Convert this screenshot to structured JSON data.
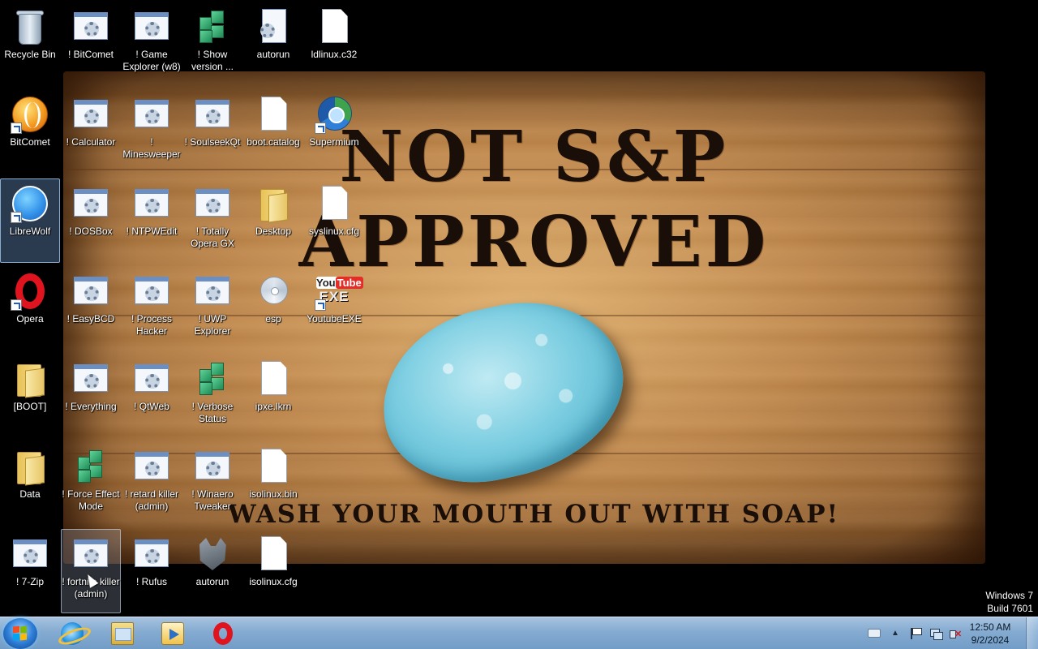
{
  "wallpaper": {
    "line1": "NOT S&P",
    "line2": "APPROVED",
    "bottom": "WASH YOUR MOUTH OUT WITH SOAP!"
  },
  "icons": [
    {
      "label": "Recycle Bin",
      "icon": "recycle-bin-icon"
    },
    {
      "label": "! BitComet",
      "icon": "app-icon"
    },
    {
      "label": "! Game Explorer (w8)",
      "icon": "app-icon"
    },
    {
      "label": "! Show version ...",
      "icon": "registry-icon"
    },
    {
      "label": "autorun",
      "icon": "settings-file-icon"
    },
    {
      "label": "ldlinux.c32",
      "icon": "file-icon"
    },
    {
      "label": "BitComet",
      "icon": "bitcomet-icon"
    },
    {
      "label": "! Calculator",
      "icon": "app-icon"
    },
    {
      "label": "! Minesweeper",
      "icon": "app-icon"
    },
    {
      "label": "! SoulseekQt",
      "icon": "app-icon"
    },
    {
      "label": "boot.catalog",
      "icon": "file-icon"
    },
    {
      "label": "Supermium",
      "icon": "supermium-icon"
    },
    {
      "label": "LibreWolf",
      "icon": "librewolf-icon"
    },
    {
      "label": "! DOSBox",
      "icon": "app-icon"
    },
    {
      "label": "! NTPWEdit",
      "icon": "app-icon"
    },
    {
      "label": "! Totally Opera GX",
      "icon": "app-icon"
    },
    {
      "label": "Desktop",
      "icon": "folder-icon"
    },
    {
      "label": "syslinux.cfg",
      "icon": "file-icon"
    },
    {
      "label": "Opera",
      "icon": "opera-icon"
    },
    {
      "label": "! EasyBCD",
      "icon": "app-icon"
    },
    {
      "label": "! Process Hacker",
      "icon": "app-icon"
    },
    {
      "label": "! UWP Explorer",
      "icon": "app-icon"
    },
    {
      "label": "esp",
      "icon": "disc-icon"
    },
    {
      "label": "YoutubeEXE",
      "icon": "youtube-exe-icon"
    },
    {
      "label": "[BOOT]",
      "icon": "folder-icon"
    },
    {
      "label": "! Everything",
      "icon": "app-icon"
    },
    {
      "label": "! QtWeb",
      "icon": "app-icon"
    },
    {
      "label": "! Verbose Status",
      "icon": "registry-icon"
    },
    {
      "label": "ipxe.lkrn",
      "icon": "file-icon"
    },
    {
      "label": "Data",
      "icon": "folder-icon"
    },
    {
      "label": "! Force Effect Mode",
      "icon": "registry-icon"
    },
    {
      "label": "! retard killer (admin)",
      "icon": "app-icon"
    },
    {
      "label": "! Winaero Tweaker",
      "icon": "app-icon"
    },
    {
      "label": "isolinux.bin",
      "icon": "file-icon"
    },
    {
      "label": "! 7-Zip",
      "icon": "app-icon"
    },
    {
      "label": "! fortnite killer (admin)",
      "icon": "app-icon"
    },
    {
      "label": "! Rufus",
      "icon": "app-icon"
    },
    {
      "label": "autorun",
      "icon": "wolf-icon"
    },
    {
      "label": "isolinux.cfg",
      "icon": "file-icon"
    }
  ],
  "os_version": {
    "line1": "Windows 7",
    "line2": "Build 7601"
  },
  "taskbar": {
    "pinned": [
      {
        "name": "internet-explorer",
        "icon": "internet-explorer-icon"
      },
      {
        "name": "windows-explorer",
        "icon": "folder-icon"
      },
      {
        "name": "media-player",
        "icon": "media-player-icon"
      },
      {
        "name": "opera",
        "icon": "opera-icon"
      }
    ],
    "clock": {
      "time": "12:50 AM",
      "date": "9/2/2024"
    }
  }
}
